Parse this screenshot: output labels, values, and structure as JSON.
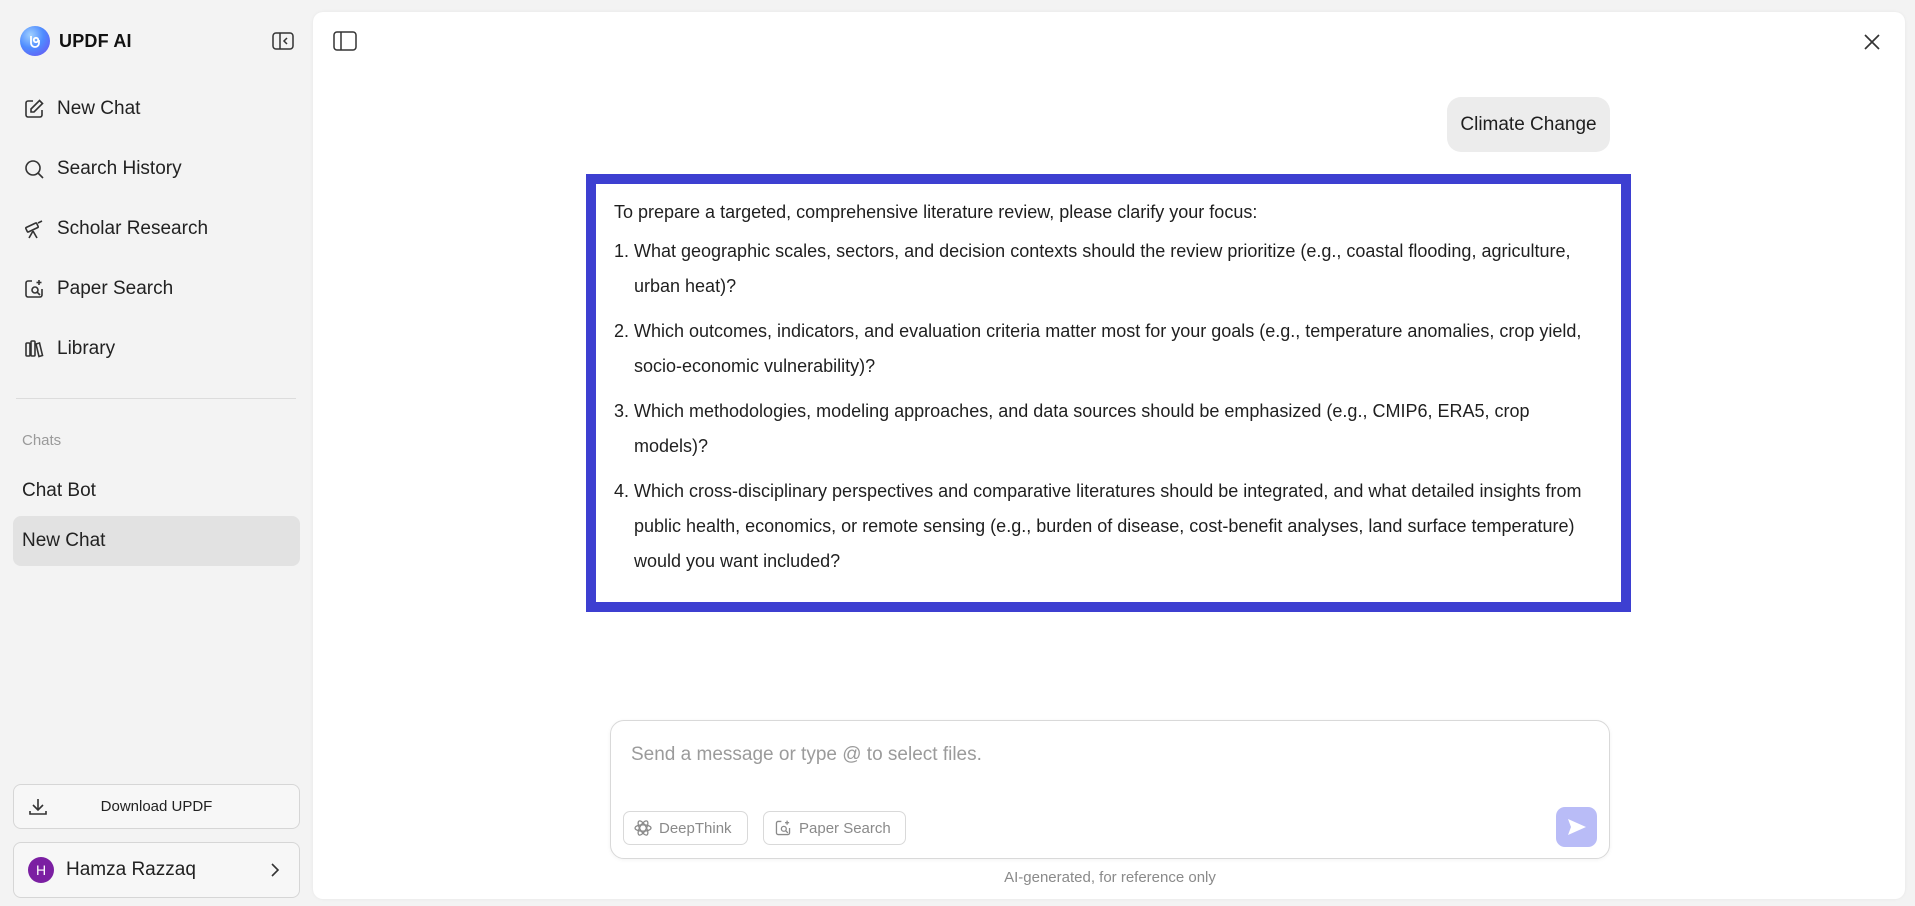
{
  "brand": {
    "name": "UPDF AI"
  },
  "sidebar": {
    "nav": [
      {
        "label": "New Chat",
        "icon": "edit-icon"
      },
      {
        "label": "Search History",
        "icon": "search-icon"
      },
      {
        "label": "Scholar Research",
        "icon": "telescope-icon"
      },
      {
        "label": "Paper Search",
        "icon": "document-search-icon"
      },
      {
        "label": "Library",
        "icon": "library-icon"
      }
    ],
    "chats_label": "Chats",
    "chats": [
      {
        "label": "Chat Bot",
        "active": false
      },
      {
        "label": "New Chat",
        "active": true
      }
    ],
    "download_label": "Download UPDF",
    "user": {
      "initial": "H",
      "name": "Hamza Razzaq",
      "avatar_color": "#7b1fa2"
    }
  },
  "conversation": {
    "user_message": "Climate Change",
    "assistant": {
      "intro": "To prepare a targeted, comprehensive literature review, please clarify your focus:",
      "items": [
        {
          "num": "1.",
          "text": "What geographic scales, sectors, and decision contexts should the review prioritize (e.g., coastal flooding, agriculture, urban heat)?"
        },
        {
          "num": "2.",
          "text": "Which outcomes, indicators, and evaluation criteria matter most for your goals (e.g., temperature anomalies, crop yield, socio-economic vulnerability)?"
        },
        {
          "num": "3.",
          "text": "Which methodologies, modeling approaches, and data sources should be emphasized (e.g., CMIP6, ERA5, crop models)?"
        },
        {
          "num": "4.",
          "text": "Which cross-disciplinary perspectives and comparative literatures should be integrated, and what detailed insights from public health, economics, or remote sensing (e.g., burden of disease, cost-benefit analyses, land surface temperature) would you want included?"
        }
      ],
      "highlight_color": "#3d3fd1"
    }
  },
  "composer": {
    "value": "",
    "placeholder": "Send a message or type @ to select files.",
    "deepthink_label": "DeepThink",
    "paper_search_label": "Paper Search",
    "send_color": "#b9bcf7"
  },
  "footnote": "AI-generated, for reference only"
}
